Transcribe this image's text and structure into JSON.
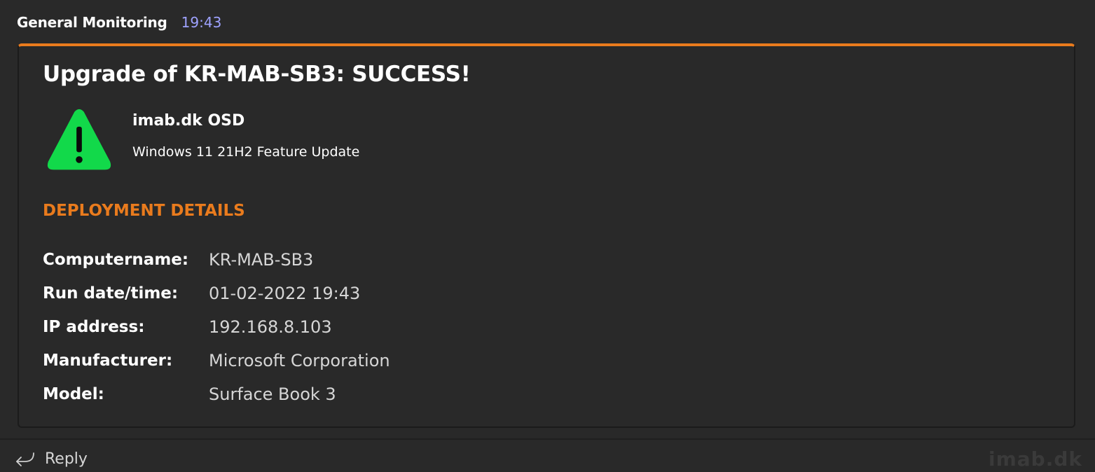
{
  "header": {
    "sender": "General Monitoring",
    "time": "19:43"
  },
  "card": {
    "accent_color": "#e97b1d",
    "title": "Upgrade of KR-MAB-SB3: SUCCESS!",
    "icon": "warning-triangle-icon",
    "icon_color": "#12d94a",
    "app_name": "imab.dk OSD",
    "app_subtitle": "Windows 11 21H2 Feature Update",
    "section_title": "DEPLOYMENT DETAILS",
    "facts": [
      {
        "label": "Computername:",
        "value": "KR-MAB-SB3"
      },
      {
        "label": "Run date/time:",
        "value": "01-02-2022 19:43"
      },
      {
        "label": "IP address:",
        "value": "192.168.8.103"
      },
      {
        "label": "Manufacturer:",
        "value": "Microsoft Corporation"
      },
      {
        "label": "Model:",
        "value": "Surface Book 3"
      }
    ]
  },
  "footer": {
    "reply_label": "Reply",
    "reply_icon": "reply-arrow-icon",
    "watermark": "imab.dk"
  }
}
